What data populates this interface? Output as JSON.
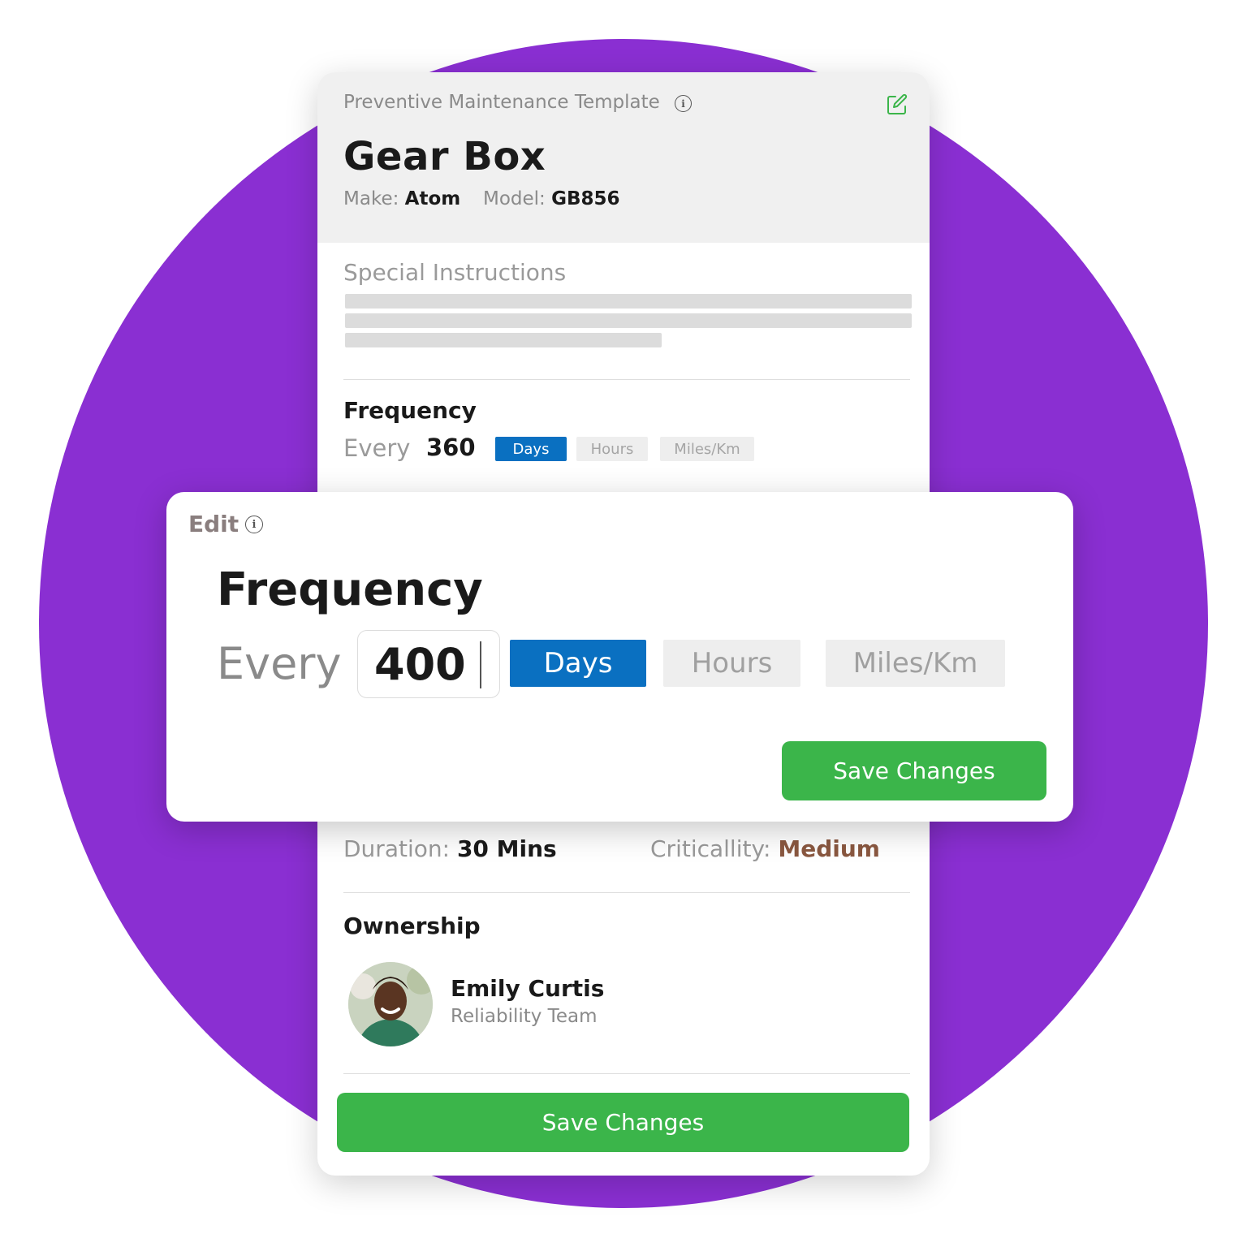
{
  "template": {
    "label": "Preventive Maintenance Template",
    "asset_name": "Gear Box",
    "make_label": "Make:",
    "make_value": "Atom",
    "model_label": "Model:",
    "model_value": "GB856"
  },
  "special_instructions": {
    "title": "Special Instructions"
  },
  "frequency": {
    "title": "Frequency",
    "every_label": "Every",
    "value": "360",
    "units": [
      "Days",
      "Hours",
      "Miles/Km"
    ],
    "selected_unit": "Days"
  },
  "details": {
    "duration_label": "Duration:",
    "duration_value": "30 Mins",
    "criticality_label": "Criticallity:",
    "criticality_value": "Medium"
  },
  "ownership": {
    "title": "Ownership",
    "owner_name": "Emily Curtis",
    "owner_team": "Reliability Team"
  },
  "save_label": "Save Changes",
  "edit_popup": {
    "label": "Edit",
    "title": "Frequency",
    "every_label": "Every",
    "value": "400",
    "units": [
      "Days",
      "Hours",
      "Miles/Km"
    ],
    "selected_unit": "Days",
    "save_label": "Save Changes"
  },
  "colors": {
    "background_circle": "#8a2fd2",
    "selected_unit": "#0a70c1",
    "save_button": "#3bb54a",
    "criticality_medium": "#8a5840",
    "edit_icon": "#3bb54a"
  },
  "icons": {
    "info": "info-icon",
    "edit": "edit-icon"
  }
}
